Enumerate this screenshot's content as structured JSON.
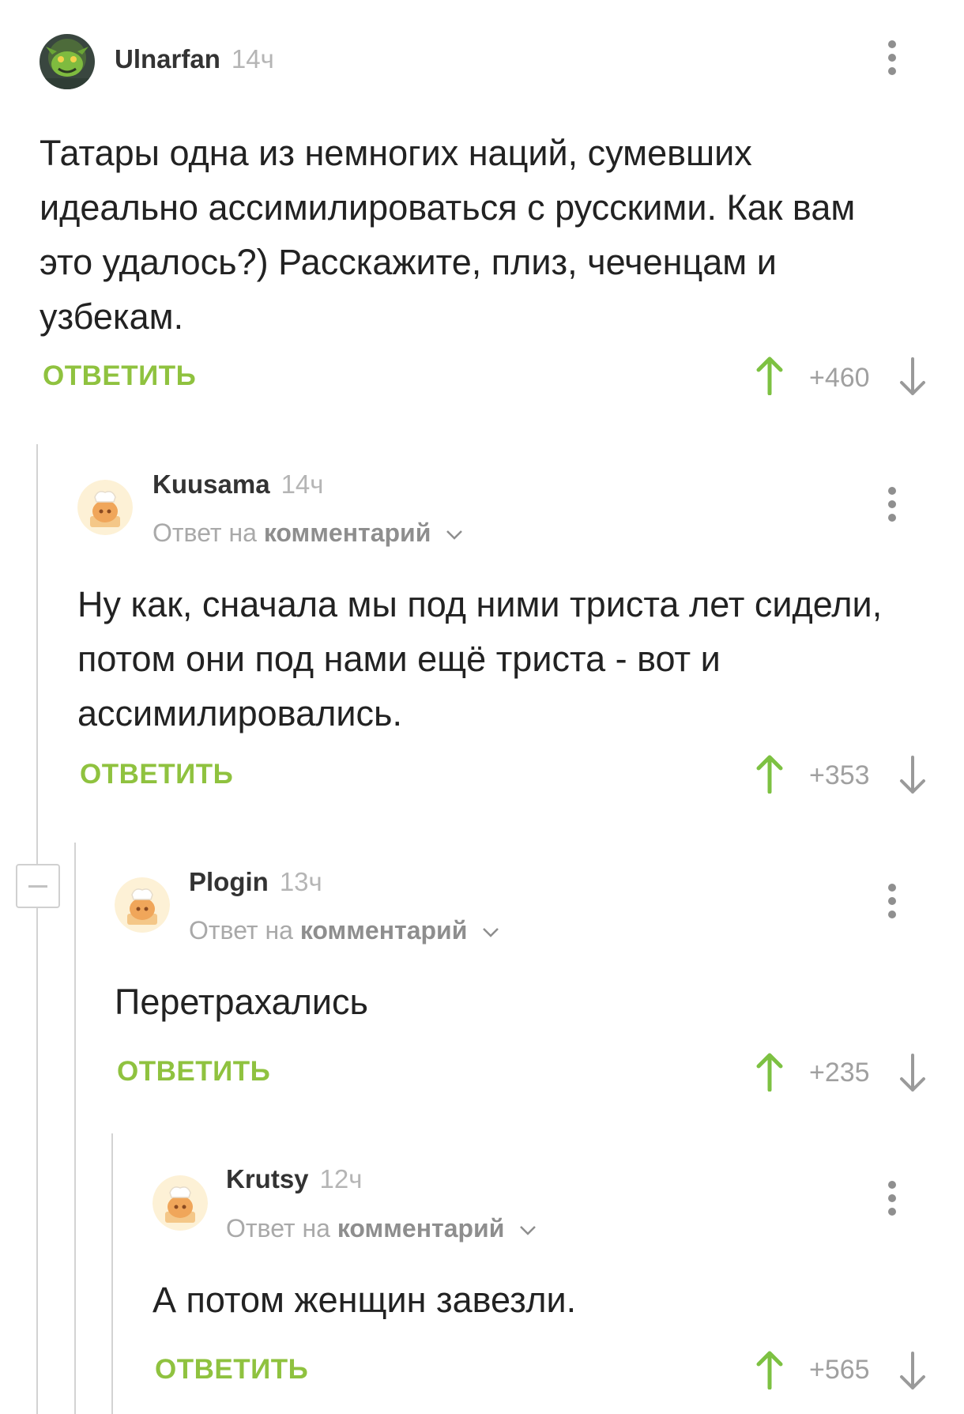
{
  "comments": [
    {
      "author": "Ulnarfan",
      "time": "14ч",
      "avatar": "goblin-avatar",
      "reply_prefix": "",
      "reply_target": "",
      "text": "Татары одна из немногих наций, сумевших идеально ассимилироваться с русскими. Как вам это удалось?) Расскажите, плиз, чеченцам и узбекам.",
      "reply_label": "ОТВЕТИТЬ",
      "score": "+460"
    },
    {
      "author": "Kuusama",
      "time": "14ч",
      "avatar": "default-avatar",
      "reply_prefix": "Ответ на",
      "reply_target": "комментарий",
      "text": "Ну как, сначала мы под ними триста лет сидели, потом они под нами ещё триста - вот и ассимилировались.",
      "reply_label": "ОТВЕТИТЬ",
      "score": "+353"
    },
    {
      "author": "Plogin",
      "time": "13ч",
      "avatar": "default-avatar",
      "reply_prefix": "Ответ на",
      "reply_target": "комментарий",
      "text": "Перетрахались",
      "reply_label": "ОТВЕТИТЬ",
      "score": "+235"
    },
    {
      "author": "Krutsy",
      "time": "12ч",
      "avatar": "default-avatar",
      "reply_prefix": "Ответ на",
      "reply_target": "комментарий",
      "text": "А потом женщин завезли.",
      "reply_label": "ОТВЕТИТЬ",
      "score": "+565"
    }
  ],
  "colors": {
    "accent_green": "#8fc23f",
    "upvote_green": "#7dc142",
    "thread_line": "#d3d3d3"
  },
  "icons": [
    "kebab-menu-icon",
    "upvote-arrow-icon",
    "downvote-arrow-icon",
    "chevron-down-icon",
    "collapse-minus-icon"
  ]
}
